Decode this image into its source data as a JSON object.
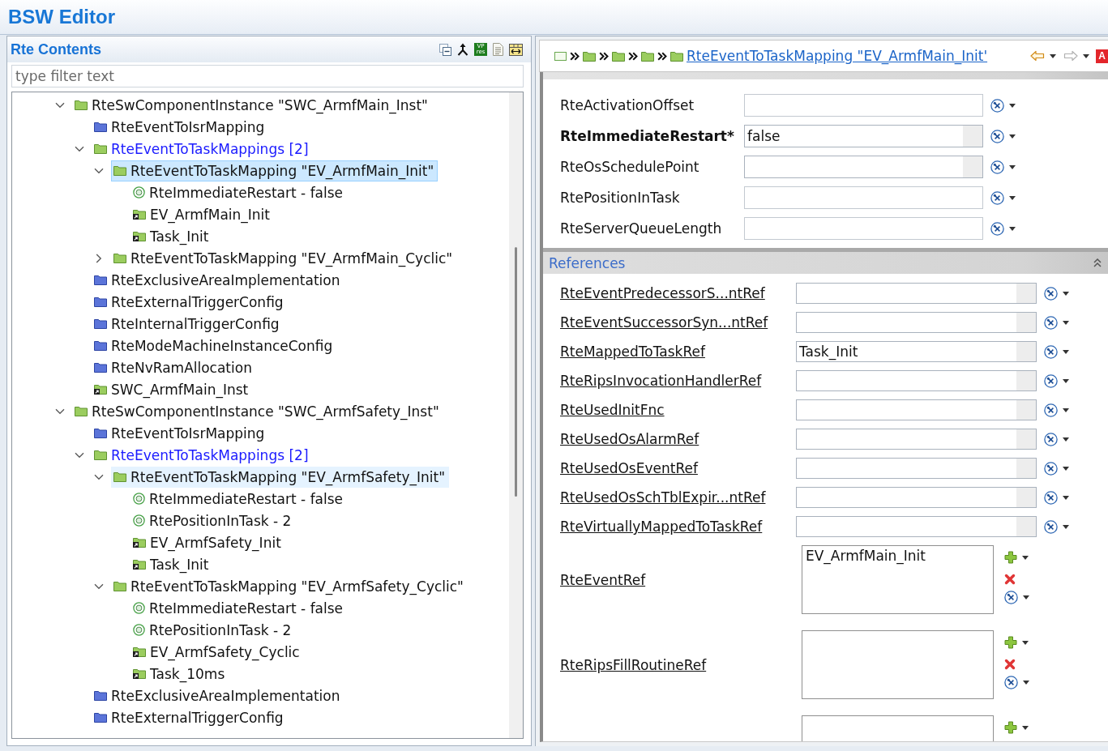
{
  "app": {
    "title": "BSW Editor"
  },
  "contents_panel": {
    "title": "Rte Contents",
    "toolbar_tile": {
      "lines": [
        "VP",
        "res"
      ]
    },
    "filter": {
      "placeholder": "type filter text"
    },
    "tree": [
      {
        "label": "RteSwComponentInstance \"SWC_ArmfMain_Inst\"",
        "kind": "container",
        "expanded": true,
        "selected": false,
        "hovered": false,
        "children": [
          {
            "label": "RteEventToIsrMapping",
            "kind": "group",
            "selected": false,
            "hovered": false
          },
          {
            "label": "RteEventToTaskMappings [2]",
            "kind": "list",
            "expanded": true,
            "selected": false,
            "hovered": false,
            "children": [
              {
                "label": "RteEventToTaskMapping \"EV_ArmfMain_Init\"",
                "kind": "container",
                "expanded": true,
                "selected": true,
                "hovered": false,
                "children": [
                  {
                    "label": "RteImmediateRestart - false",
                    "kind": "param",
                    "selected": false,
                    "hovered": false
                  },
                  {
                    "label": "EV_ArmfMain_Init",
                    "kind": "reference",
                    "selected": false,
                    "hovered": false
                  },
                  {
                    "label": "Task_Init",
                    "kind": "reference",
                    "selected": false,
                    "hovered": false
                  }
                ]
              },
              {
                "label": "RteEventToTaskMapping \"EV_ArmfMain_Cyclic\"",
                "kind": "container",
                "expanded": false,
                "selected": false,
                "hovered": false
              }
            ]
          },
          {
            "label": "RteExclusiveAreaImplementation",
            "kind": "group",
            "selected": false,
            "hovered": false
          },
          {
            "label": "RteExternalTriggerConfig",
            "kind": "group",
            "selected": false,
            "hovered": false
          },
          {
            "label": "RteInternalTriggerConfig",
            "kind": "group",
            "selected": false,
            "hovered": false
          },
          {
            "label": "RteModeMachineInstanceConfig",
            "kind": "group",
            "selected": false,
            "hovered": false
          },
          {
            "label": "RteNvRamAllocation",
            "kind": "group",
            "selected": false,
            "hovered": false
          },
          {
            "label": "SWC_ArmfMain_Inst",
            "kind": "reference",
            "selected": false,
            "hovered": false
          }
        ]
      },
      {
        "label": "RteSwComponentInstance \"SWC_ArmfSafety_Inst\"",
        "kind": "container",
        "expanded": true,
        "selected": false,
        "hovered": false,
        "children": [
          {
            "label": "RteEventToIsrMapping",
            "kind": "group",
            "selected": false,
            "hovered": false
          },
          {
            "label": "RteEventToTaskMappings [2]",
            "kind": "list",
            "expanded": true,
            "selected": false,
            "hovered": false,
            "children": [
              {
                "label": "RteEventToTaskMapping \"EV_ArmfSafety_Init\"",
                "kind": "container",
                "expanded": true,
                "selected": false,
                "hovered": true,
                "children": [
                  {
                    "label": "RteImmediateRestart - false",
                    "kind": "param",
                    "selected": false,
                    "hovered": false
                  },
                  {
                    "label": "RtePositionInTask - 2",
                    "kind": "param",
                    "selected": false,
                    "hovered": false
                  },
                  {
                    "label": "EV_ArmfSafety_Init",
                    "kind": "reference",
                    "selected": false,
                    "hovered": false
                  },
                  {
                    "label": "Task_Init",
                    "kind": "reference",
                    "selected": false,
                    "hovered": false
                  }
                ]
              },
              {
                "label": "RteEventToTaskMapping \"EV_ArmfSafety_Cyclic\"",
                "kind": "container",
                "expanded": true,
                "selected": false,
                "hovered": false,
                "children": [
                  {
                    "label": "RteImmediateRestart - false",
                    "kind": "param",
                    "selected": false,
                    "hovered": false
                  },
                  {
                    "label": "RtePositionInTask - 2",
                    "kind": "param",
                    "selected": false,
                    "hovered": false
                  },
                  {
                    "label": "EV_ArmfSafety_Cyclic",
                    "kind": "reference",
                    "selected": false,
                    "hovered": false
                  },
                  {
                    "label": "Task_10ms",
                    "kind": "reference",
                    "selected": false,
                    "hovered": false
                  }
                ]
              }
            ]
          },
          {
            "label": "RteExclusiveAreaImplementation",
            "kind": "group",
            "selected": false,
            "hovered": false
          },
          {
            "label": "RteExternalTriggerConfig",
            "kind": "group",
            "selected": false,
            "hovered": false
          }
        ]
      }
    ]
  },
  "editor_panel": {
    "breadcrumb": {
      "path": [
        {
          "kind": "root"
        },
        {
          "kind": "folder"
        },
        {
          "kind": "folder"
        },
        {
          "kind": "folder"
        }
      ],
      "current": {
        "kind": "folder",
        "label": "RteEventToTaskMapping \"EV_ArmfMain_Init'"
      }
    },
    "navigation": [
      {
        "kind": "back",
        "enabled": true
      },
      {
        "kind": "forward",
        "enabled": false
      }
    ],
    "tile_button": {
      "label": "A"
    },
    "attributes": [
      {
        "label": "RteActivationOffset",
        "required": false,
        "kind": "text"
      },
      {
        "label": "RteImmediateRestart*",
        "required": true,
        "kind": "combo",
        "value": "false"
      },
      {
        "label": "RteOsSchedulePoint",
        "required": false,
        "kind": "combo"
      },
      {
        "label": "RtePositionInTask",
        "required": false,
        "kind": "text"
      },
      {
        "label": "RteServerQueueLength",
        "required": false,
        "kind": "text"
      }
    ],
    "references_title": "References",
    "references": [
      {
        "kind": "single",
        "label": "RteEventPredecessorS...ntRef"
      },
      {
        "kind": "single",
        "label": "RteEventSuccessorSyn...ntRef"
      },
      {
        "kind": "single",
        "label": "RteMappedToTaskRef",
        "value": "Task_Init"
      },
      {
        "kind": "single",
        "label": "RteRipsInvocationHandlerRef"
      },
      {
        "kind": "single",
        "label": "RteUsedInitFnc"
      },
      {
        "kind": "single",
        "label": "RteUsedOsAlarmRef"
      },
      {
        "kind": "single",
        "label": "RteUsedOsEventRef"
      },
      {
        "kind": "single",
        "label": "RteUsedOsSchTblExpir...ntRef"
      },
      {
        "kind": "single",
        "label": "RteVirtuallyMappedToTaskRef"
      },
      {
        "kind": "list",
        "label": "RteEventRef",
        "values": [
          "EV_ArmfMain_Init"
        ]
      },
      {
        "kind": "list",
        "label": "RteRipsFillRoutineRef"
      },
      {
        "kind": "list"
      }
    ]
  }
}
